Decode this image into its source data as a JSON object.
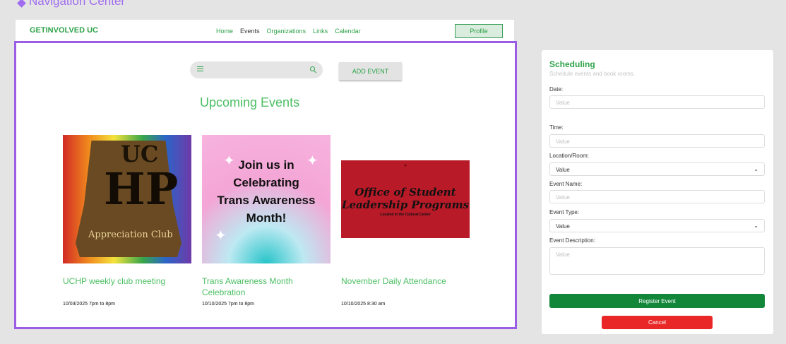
{
  "frame_title": "Navigation Center",
  "navbar": {
    "brand": "GETINVOLVED UC",
    "links": [
      "Home",
      "Events",
      "Organizations",
      "Links",
      "Calendar"
    ],
    "active_link": "Events",
    "profile_label": "Profile"
  },
  "toolbar": {
    "search_icon": "search-icon",
    "menu_icon": "hamburger-icon",
    "add_event_label": "ADD EVENT"
  },
  "section_title": "Upcoming Events",
  "events": [
    {
      "title": "UCHP weekly club meeting",
      "date": "10/03/2025 7pm to 8pm",
      "image_text": [
        "UC",
        "HP",
        "Appreciation Club"
      ]
    },
    {
      "title": "Trans Awareness Month Celebration",
      "date": "10/10/2025 7pm to 8pm",
      "image_text": [
        "Join us in",
        "Celebrating",
        "Trans Awareness",
        "Month!"
      ]
    },
    {
      "title": "November Daily Attendance",
      "date": "10/10/2025 8:30 am",
      "image_text": [
        "Office of Student",
        "Leadership Programs",
        "Located in the Cultural Center"
      ]
    }
  ],
  "scheduling": {
    "title": "Scheduling",
    "subtitle": "Schedule events and book rooms.",
    "fields": {
      "date_label": "Date:",
      "date_placeholder": "Value",
      "time_label": "Time:",
      "time_placeholder": "Value",
      "location_label": "Location/Room:",
      "location_value": "Value",
      "event_name_label": "Event Name:",
      "event_name_placeholder": "Value",
      "event_type_label": "Event Type:",
      "event_type_value": "Value",
      "description_label": "Event Description:",
      "description_placeholder": "Value"
    },
    "register_label": "Register Event",
    "cancel_label": "Cancel"
  },
  "colors": {
    "accent_green": "#2ea24a",
    "frame_purple": "#9b5de5",
    "register_green": "#12873a",
    "cancel_red": "#e92727"
  }
}
